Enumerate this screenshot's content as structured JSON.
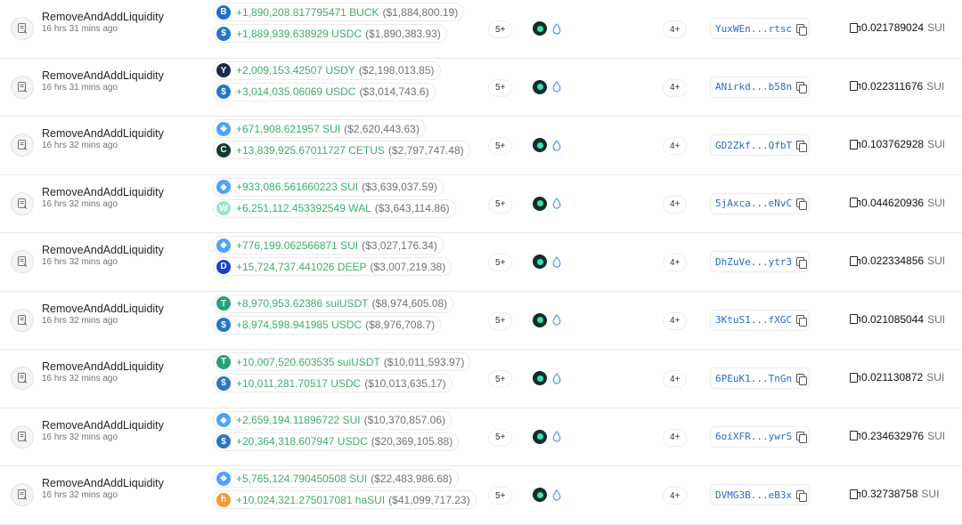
{
  "colors": {
    "positive": "#3cae6e",
    "muted": "#6a737d",
    "address": "#2a6ac8"
  },
  "token_styles": {
    "BUCK": {
      "bg": "#1c6fd0",
      "glyph": "B"
    },
    "USDC": {
      "bg": "#2775ca",
      "glyph": "$"
    },
    "USDY": {
      "bg": "#1b2a4a",
      "glyph": "Y"
    },
    "SUI": {
      "bg": "#4da2ff",
      "glyph": "◆"
    },
    "CETUS": {
      "bg": "#0f3b33",
      "glyph": "C"
    },
    "WAL": {
      "bg": "#9be7c4",
      "glyph": "W"
    },
    "DEEP": {
      "bg": "#1a3fd6",
      "glyph": "D"
    },
    "suiUSDT": {
      "bg": "#26a17b",
      "glyph": "T"
    },
    "haSUI": {
      "bg": "#f39c35",
      "glyph": "h"
    }
  },
  "rows": [
    {
      "name": "RemoveAndAddLiquidity",
      "time": "16 hrs 31 mins ago",
      "changes": [
        {
          "amount": "+1,890,208.817795471 BUCK",
          "usd": "($1,884,800.19)",
          "token": "BUCK"
        },
        {
          "amount": "+1,889,939.638929 USDC",
          "usd": "($1,890,383.93)",
          "token": "USDC"
        }
      ],
      "count_a": "5+",
      "count_b": "4+",
      "address": "YuxWEn...rtsc",
      "fee": "0.021789024",
      "fee_unit": "SUI"
    },
    {
      "name": "RemoveAndAddLiquidity",
      "time": "16 hrs 31 mins ago",
      "changes": [
        {
          "amount": "+2,009,153.42507 USDY",
          "usd": "($2,198,013.85)",
          "token": "USDY"
        },
        {
          "amount": "+3,014,035.06069 USDC",
          "usd": "($3,014,743.6)",
          "token": "USDC"
        }
      ],
      "count_a": "5+",
      "count_b": "4+",
      "address": "ANirkd...b58n",
      "fee": "0.022311676",
      "fee_unit": "SUI"
    },
    {
      "name": "RemoveAndAddLiquidity",
      "time": "16 hrs 32 mins ago",
      "changes": [
        {
          "amount": "+671,908.621957 SUI",
          "usd": "($2,620,443.63)",
          "token": "SUI"
        },
        {
          "amount": "+13,839,925.67011727 CETUS",
          "usd": "($2,797,747.48)",
          "token": "CETUS"
        }
      ],
      "count_a": "5+",
      "count_b": "4+",
      "address": "GD2Zkf...QfbT",
      "fee": "0.103762928",
      "fee_unit": "SUI"
    },
    {
      "name": "RemoveAndAddLiquidity",
      "time": "16 hrs 32 mins ago",
      "changes": [
        {
          "amount": "+933,086.561660223 SUI",
          "usd": "($3,639,037.59)",
          "token": "SUI"
        },
        {
          "amount": "+6,251,112.453392549 WAL",
          "usd": "($3,643,114.86)",
          "token": "WAL"
        }
      ],
      "count_a": "5+",
      "count_b": "4+",
      "address": "5jAxca...eNvC",
      "fee": "0.044620936",
      "fee_unit": "SUI"
    },
    {
      "name": "RemoveAndAddLiquidity",
      "time": "16 hrs 32 mins ago",
      "changes": [
        {
          "amount": "+776,199.062566871 SUI",
          "usd": "($3,027,176.34)",
          "token": "SUI"
        },
        {
          "amount": "+15,724,737.441026 DEEP",
          "usd": "($3,007,219.38)",
          "token": "DEEP"
        }
      ],
      "count_a": "5+",
      "count_b": "4+",
      "address": "DhZuVe...ytr3",
      "fee": "0.022334856",
      "fee_unit": "SUI"
    },
    {
      "name": "RemoveAndAddLiquidity",
      "time": "16 hrs 32 mins ago",
      "changes": [
        {
          "amount": "+8,970,953.62386 suiUSDT",
          "usd": "($8,974,605.08)",
          "token": "suiUSDT"
        },
        {
          "amount": "+8,974,598.941985 USDC",
          "usd": "($8,976,708.7)",
          "token": "USDC"
        }
      ],
      "count_a": "5+",
      "count_b": "4+",
      "address": "3KtuS1...fXGC",
      "fee": "0.021085044",
      "fee_unit": "SUI"
    },
    {
      "name": "RemoveAndAddLiquidity",
      "time": "16 hrs 32 mins ago",
      "changes": [
        {
          "amount": "+10,007,520.603535 suiUSDT",
          "usd": "($10,011,593.97)",
          "token": "suiUSDT"
        },
        {
          "amount": "+10,011,281.70517 USDC",
          "usd": "($10,013,635.17)",
          "token": "USDC"
        }
      ],
      "count_a": "5+",
      "count_b": "4+",
      "address": "6PEuK1...TnGn",
      "fee": "0.021130872",
      "fee_unit": "SUI"
    },
    {
      "name": "RemoveAndAddLiquidity",
      "time": "16 hrs 32 mins ago",
      "changes": [
        {
          "amount": "+2,659,194.11896722 SUI",
          "usd": "($10,370,857.06)",
          "token": "SUI"
        },
        {
          "amount": "+20,364,318.607947 USDC",
          "usd": "($20,369,105.88)",
          "token": "USDC"
        }
      ],
      "count_a": "5+",
      "count_b": "4+",
      "address": "6oiXFR...ywrS",
      "fee": "0.234632976",
      "fee_unit": "SUI"
    },
    {
      "name": "RemoveAndAddLiquidity",
      "time": "16 hrs 32 mins ago",
      "changes": [
        {
          "amount": "+5,765,124.790450508 SUI",
          "usd": "($22,483,986.68)",
          "token": "SUI"
        },
        {
          "amount": "+10,024,321.275017081 haSUI",
          "usd": "($41,099,717.23)",
          "token": "haSUI"
        }
      ],
      "count_a": "5+",
      "count_b": "4+",
      "address": "DVMG3B...eB3x",
      "fee": "0.32738758",
      "fee_unit": "SUI"
    }
  ]
}
